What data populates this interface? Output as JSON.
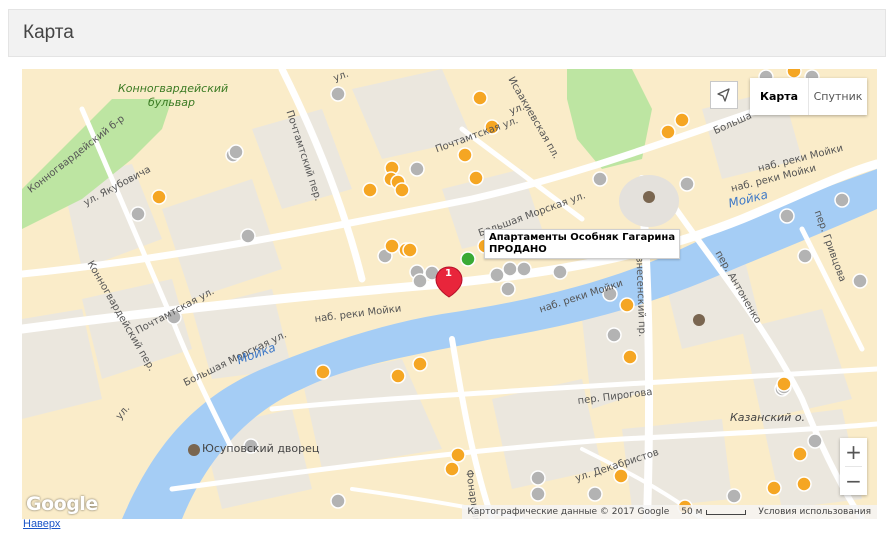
{
  "header": {
    "title": "Карта"
  },
  "map": {
    "type_controls": {
      "map_label": "Карта",
      "satellite_label": "Спутник"
    },
    "labels": {
      "konnogv_bulvar_1": "Конногвардейский",
      "konnogv_bulvar_2": "бульвар",
      "konnogv_bulvar_short": "Конногвардейский б-р",
      "yakubovicha": "ул. Якубовича",
      "pochtamtskaya_1": "Почтамтская ул.",
      "pochtamtskaya_2": "Почтамтская ул.",
      "pochtamtsky_per": "Почтамтский пер.",
      "isaakievskaya": "Исаакиевская пл.",
      "bolshaya_morskaya_1": "Большая Морская ул.",
      "bolshaya_morskaya_2": "Большая Морская ул.",
      "moyka_1": "Мойка",
      "moyka_2": "Мойка",
      "nab_moyki_1": "наб. реки Мойки",
      "nab_moyki_2": "наб. реки Мойки",
      "nab_moyki_3": "наб. реки Мойки",
      "konnogv_per": "Конногвардейский пер.",
      "angliyskaya_ul": "ул.",
      "pirogova": "пер. Пирогова",
      "dekabristov": "ул. Декабристов",
      "antonenko": "пер. Антоненко",
      "grivtsova": "пер. Гривцова",
      "voznesensky": "Вознесенский пр.",
      "kazansky": "Казанский о.",
      "yusupovsky": "Юсуповский дворец",
      "fonarny": "Фонарный",
      "bolshaya_ul": "Больша",
      "vosrk_ul": "ул.",
      "ul_top": "ул.",
      "bulv_6": "Конногвардейский б-р",
      "reki_moyki_top": "наб. реки Мойки"
    },
    "marker_number": "1",
    "info_popup": {
      "line1": "Апартаменты Особняк Гагарина",
      "line2": "ПРОДАНО"
    },
    "zoom": {
      "in": "+",
      "out": "−"
    },
    "logo": "Google",
    "attribution": {
      "data": "Картографические данные © 2017 Google",
      "scale": "50 м",
      "terms": "Условия использования"
    },
    "colors": {
      "water": "#a5cdf5",
      "park": "#bde5a2",
      "road": "#ffffff",
      "block": "#faecc9",
      "building": "#e4e1dc",
      "orange_point": "#f5a623",
      "gray_point": "#b3b3b3",
      "green_point": "#3aaa35",
      "red_marker": "#e8253b"
    }
  },
  "footer": {
    "back_link": "Наверх"
  }
}
